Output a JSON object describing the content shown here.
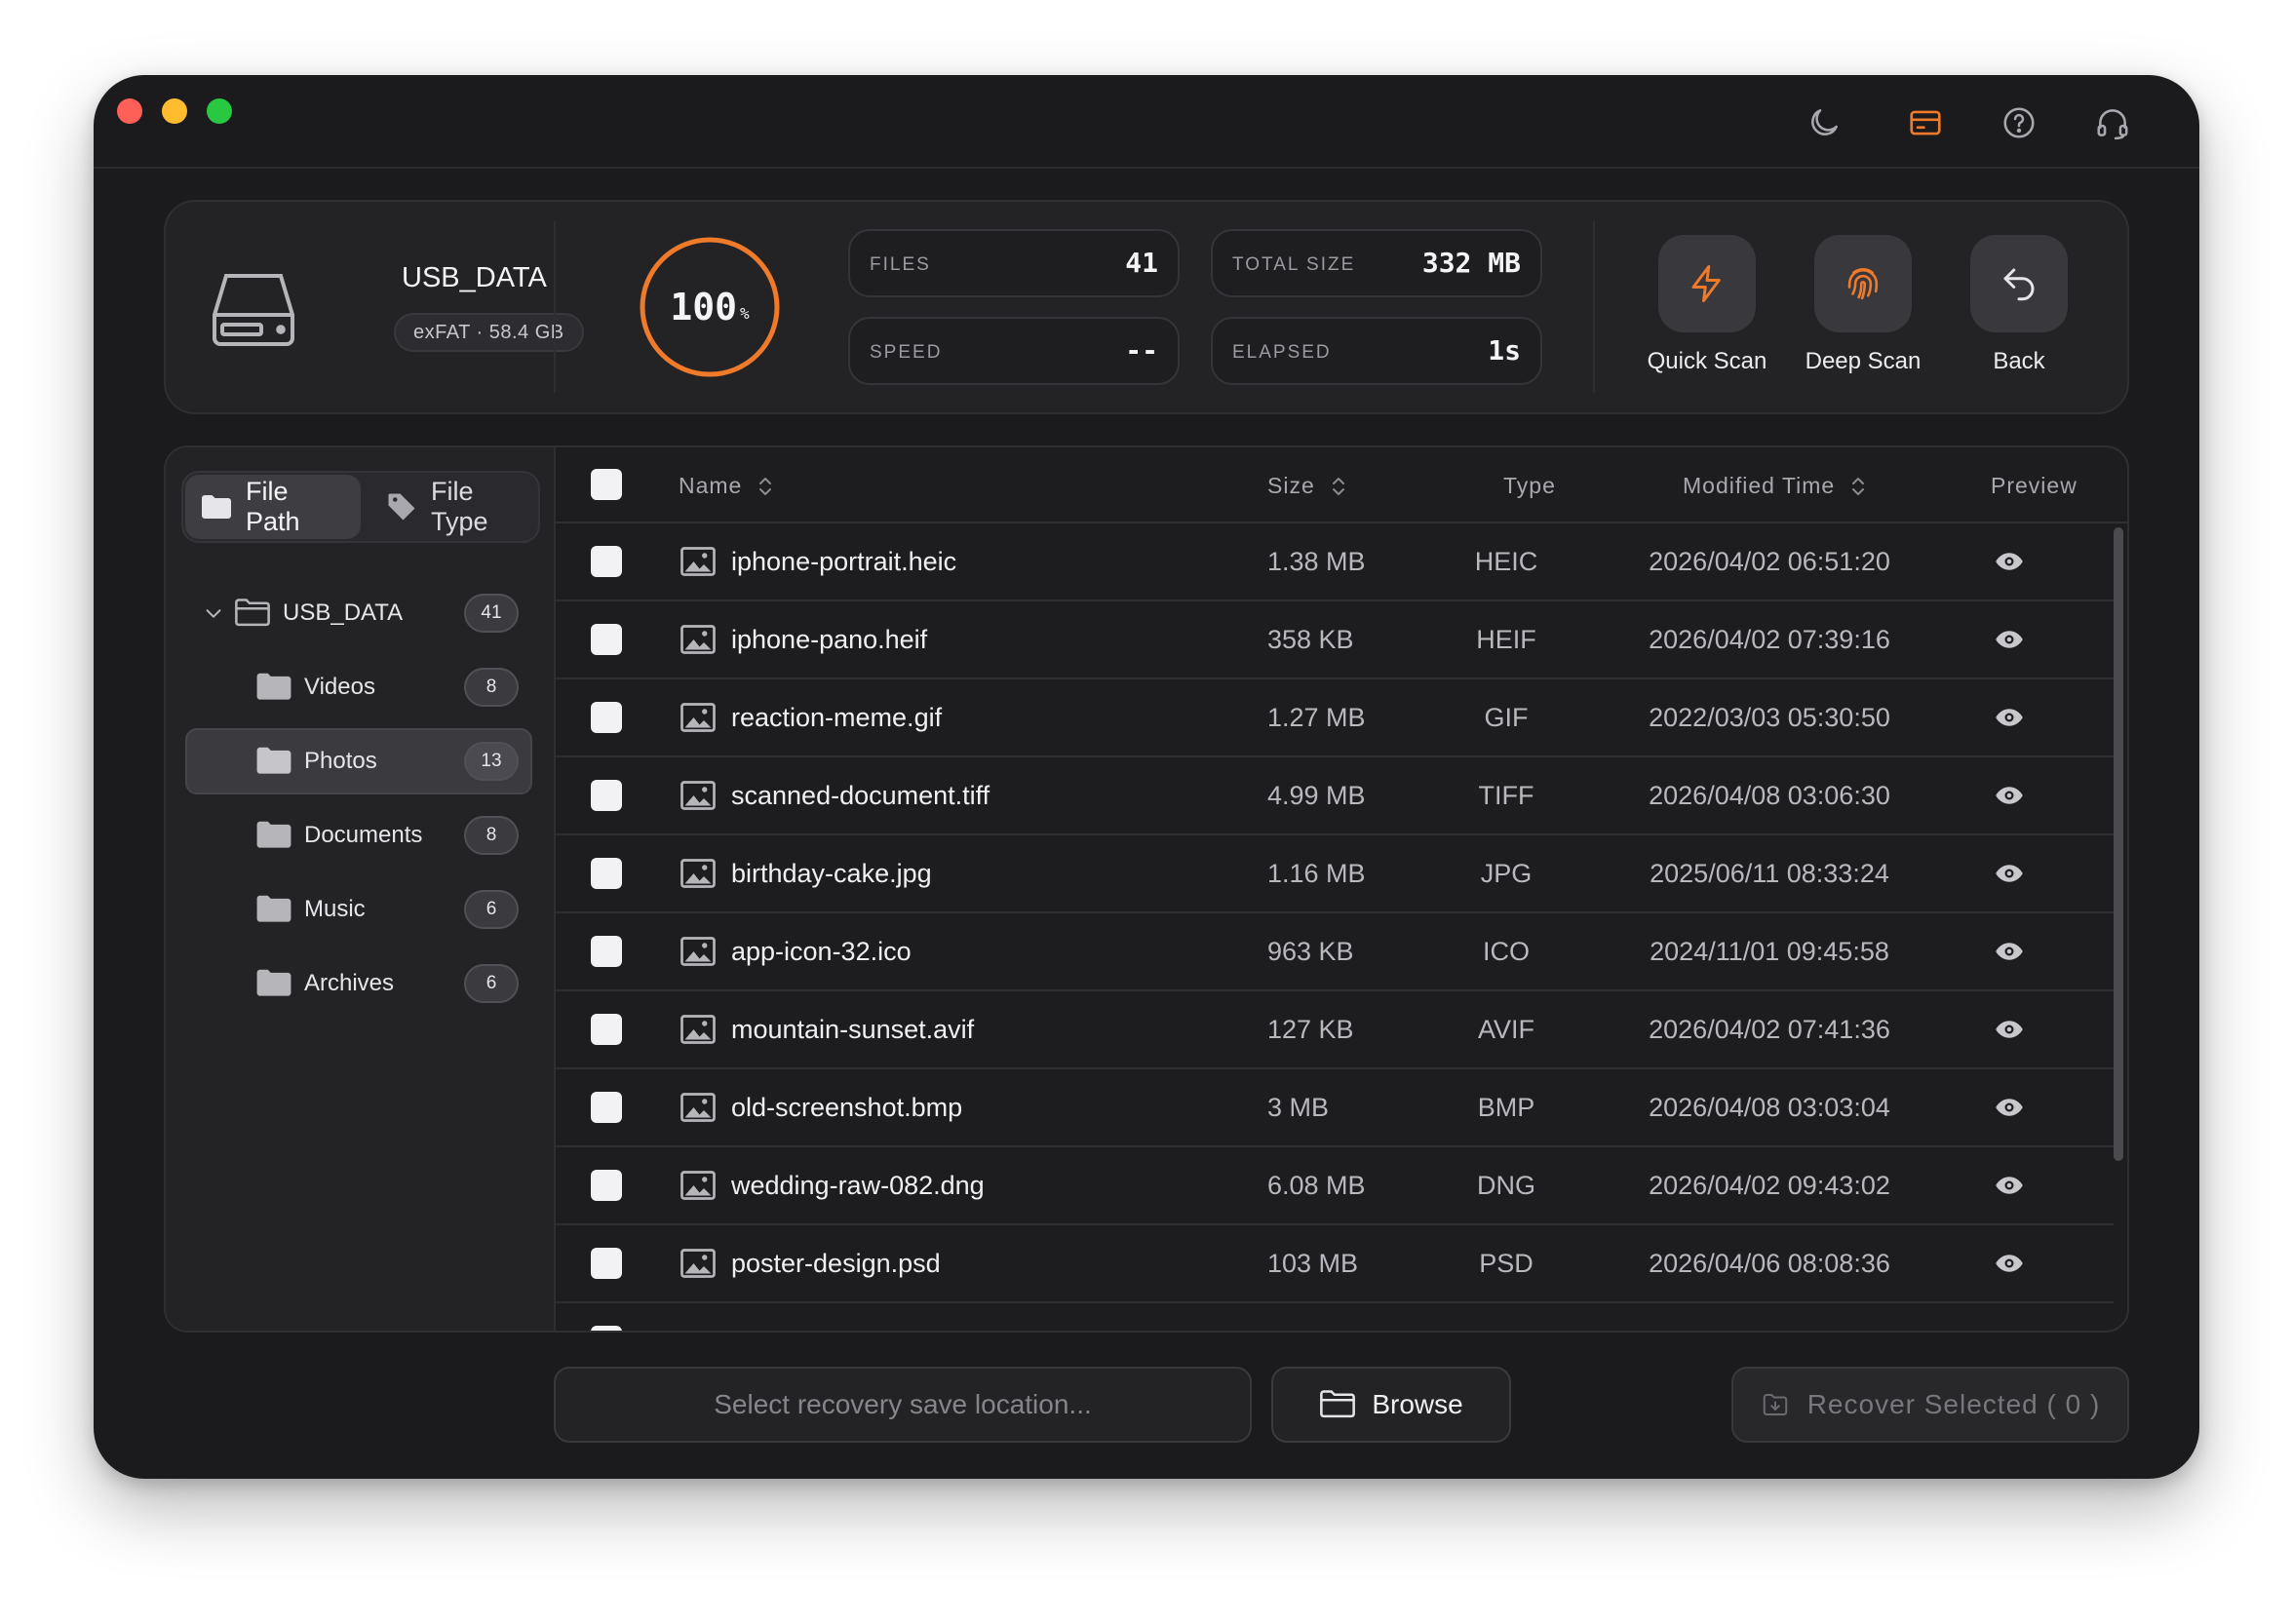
{
  "titlebar": {
    "icons": [
      "moon-icon",
      "card-icon",
      "help-icon",
      "headset-icon"
    ],
    "accent_color": "#ee7a2a"
  },
  "drive": {
    "name": "USB_DATA",
    "info": "exFAT · 58.4 GB",
    "icon": "drive-icon"
  },
  "progress": {
    "value": "100",
    "unit": "%",
    "fraction": 1.0
  },
  "stats": {
    "files_label": "FILES",
    "files_value": "41",
    "total_size_label": "TOTAL SIZE",
    "total_size_value": "332 MB",
    "speed_label": "SPEED",
    "speed_value": "--",
    "elapsed_label": "ELAPSED",
    "elapsed_value": "1s"
  },
  "actions": {
    "quick_scan": "Quick Scan",
    "deep_scan": "Deep Scan",
    "back": "Back"
  },
  "sidebar": {
    "tabs": [
      {
        "label": "File Path",
        "icon": "folder-icon",
        "active": true
      },
      {
        "label": "File Type",
        "icon": "tag-icon",
        "active": false
      }
    ],
    "root": {
      "label": "USB_DATA",
      "count": "41"
    },
    "items": [
      {
        "label": "Videos",
        "count": "8"
      },
      {
        "label": "Photos",
        "count": "13",
        "selected": true
      },
      {
        "label": "Documents",
        "count": "8"
      },
      {
        "label": "Music",
        "count": "6"
      },
      {
        "label": "Archives",
        "count": "6"
      }
    ]
  },
  "table": {
    "headers": {
      "name": "Name",
      "size": "Size",
      "type": "Type",
      "modified": "Modified Time",
      "preview": "Preview"
    },
    "rows": [
      {
        "name": "iphone-portrait.heic",
        "size": "1.38 MB",
        "type": "HEIC",
        "modified": "2026/04/02 06:51:20"
      },
      {
        "name": "iphone-pano.heif",
        "size": "358 KB",
        "type": "HEIF",
        "modified": "2026/04/02 07:39:16"
      },
      {
        "name": "reaction-meme.gif",
        "size": "1.27 MB",
        "type": "GIF",
        "modified": "2022/03/03 05:30:50"
      },
      {
        "name": "scanned-document.tiff",
        "size": "4.99 MB",
        "type": "TIFF",
        "modified": "2026/04/08 03:06:30"
      },
      {
        "name": "birthday-cake.jpg",
        "size": "1.16 MB",
        "type": "JPG",
        "modified": "2025/06/11 08:33:24"
      },
      {
        "name": "app-icon-32.ico",
        "size": "963 KB",
        "type": "ICO",
        "modified": "2024/11/01 09:45:58"
      },
      {
        "name": "mountain-sunset.avif",
        "size": "127 KB",
        "type": "AVIF",
        "modified": "2026/04/02 07:41:36"
      },
      {
        "name": "old-screenshot.bmp",
        "size": "3 MB",
        "type": "BMP",
        "modified": "2026/04/08 03:03:04"
      },
      {
        "name": "wedding-raw-082.dng",
        "size": "6.08 MB",
        "type": "DNG",
        "modified": "2026/04/02 09:43:02"
      },
      {
        "name": "poster-design.psd",
        "size": "103 MB",
        "type": "PSD",
        "modified": "2026/04/06 08:08:36"
      }
    ]
  },
  "footer": {
    "save_placeholder": "Select recovery save location...",
    "browse_label": "Browse",
    "recover_label": "Recover Selected ( 0 )"
  }
}
